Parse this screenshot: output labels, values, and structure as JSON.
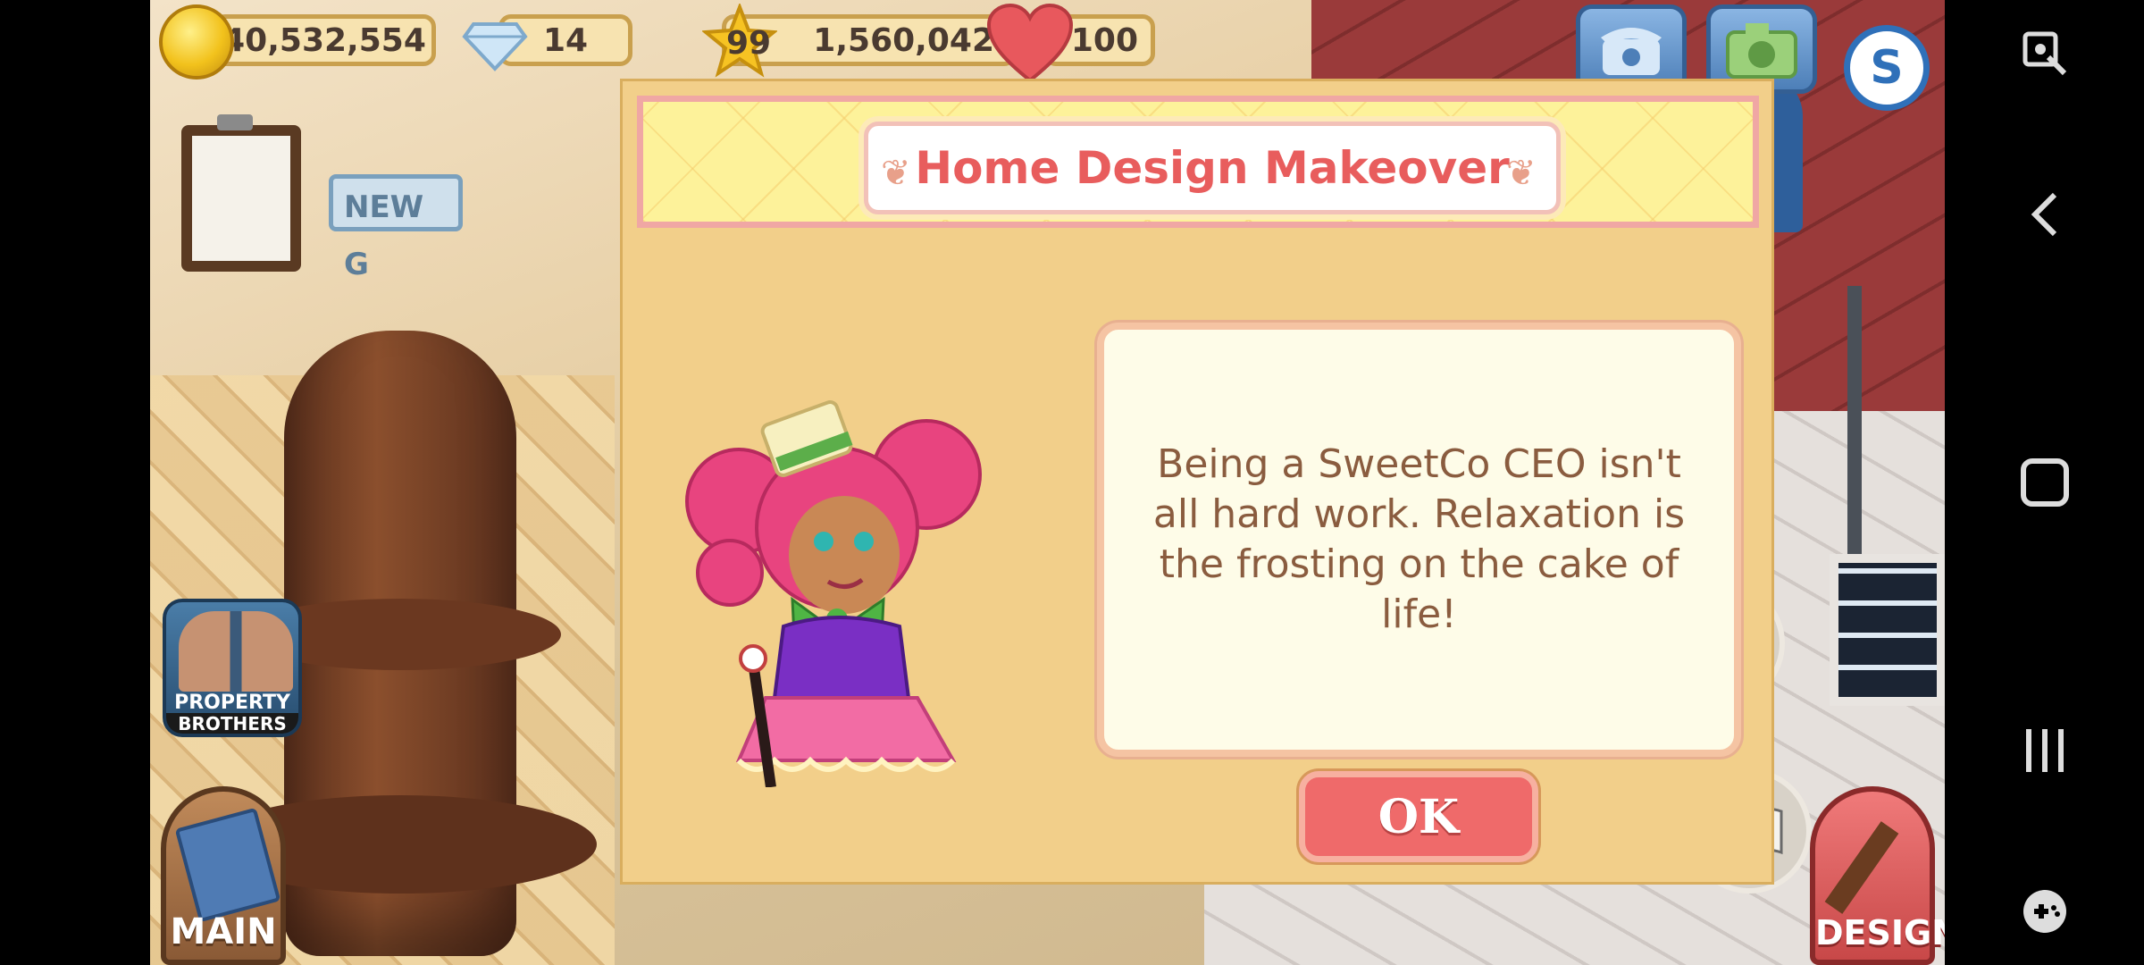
{
  "hud": {
    "coins": "40,532,554",
    "gems": "14",
    "level": "99",
    "xp": "1,560,042",
    "hearts": "100"
  },
  "background": {
    "sign_text": "NEW G"
  },
  "left_panel": {
    "promo_line1": "PROPERTY",
    "promo_line2": "BROTHERS",
    "main_label": "MAIN"
  },
  "right_panel": {
    "design_label": "DESIGN",
    "s_button": "S"
  },
  "dialog": {
    "title": "Home Design Makeover",
    "message": "Being a SweetCo CEO isn't all hard work. Relaxation is the frosting on the cake of life!",
    "ok_label": "OK"
  },
  "colors": {
    "dialog_bg": "#f2cf8a",
    "title_red": "#e85d5d",
    "ok_red": "#ef6a6a",
    "text_brown": "#8a5c3f"
  },
  "icons": [
    "coin-icon",
    "gem-icon",
    "star-icon",
    "heart-icon",
    "phone-icon",
    "camera-icon",
    "screenshot-icon",
    "back-icon",
    "home-icon",
    "recents-icon",
    "gamepad-icon"
  ]
}
